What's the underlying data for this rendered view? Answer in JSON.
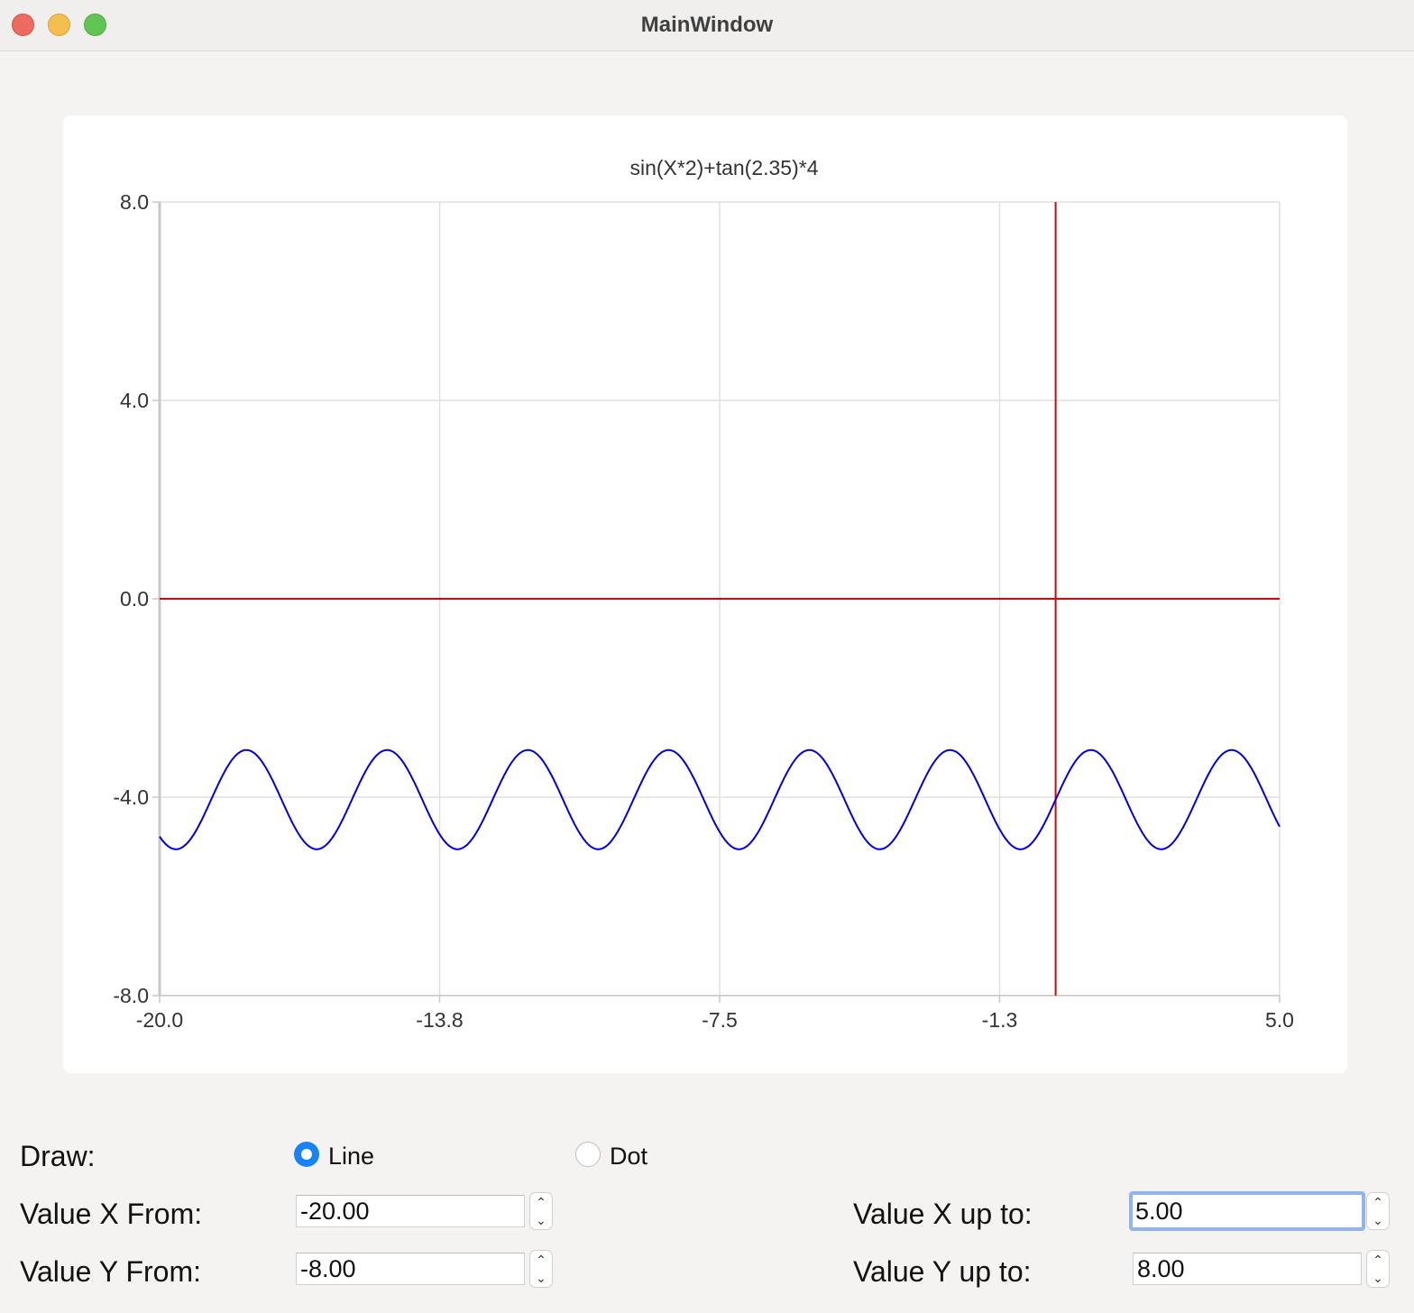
{
  "window": {
    "title": "MainWindow"
  },
  "chart_data": {
    "type": "line",
    "title": "sin(X*2)+tan(2.35)*4",
    "xlabel": "",
    "ylabel": "",
    "xlim": [
      -20.0,
      5.0
    ],
    "ylim": [
      -8.0,
      8.0
    ],
    "x_ticks": [
      "-20.0",
      "-13.8",
      "-7.5",
      "-1.3",
      "5.0"
    ],
    "y_ticks": [
      "8.0",
      "4.0",
      "0.0",
      "-4.0",
      "-8.0"
    ],
    "grid": true,
    "x_tick_values": [
      -20.0,
      -13.75,
      -7.5,
      -1.25,
      5.0
    ],
    "y_tick_values": [
      8.0,
      4.0,
      0.0,
      -4.0,
      -8.0
    ],
    "axes_lines": {
      "horizontal_y": 0.0,
      "vertical_x": 0.0,
      "color": "#e00000"
    },
    "series": [
      {
        "function": "sin(X*2)+tan(2.35)*4",
        "color": "#0000dd",
        "x": [
          -20.0,
          -19.5,
          -19.0,
          -18.5,
          -18.0,
          -17.5,
          -17.0,
          -16.5,
          -16.0,
          -15.5,
          -15.0,
          -14.5,
          -14.0,
          -13.5,
          -13.0,
          -12.5,
          -12.0,
          -11.5,
          -11.0,
          -10.5,
          -10.0,
          -9.5,
          -9.0,
          -8.5,
          -8.0,
          -7.5,
          -7.0,
          -6.5,
          -6.0,
          -5.5,
          -5.0,
          -4.5,
          -4.0,
          -3.5,
          -3.0,
          -2.5,
          -2.0,
          -1.5,
          -1.0,
          -0.5,
          0.0,
          0.5,
          1.0,
          1.5,
          2.0,
          2.5,
          3.0,
          3.5,
          4.0,
          4.5,
          5.0
        ],
        "y": [
          -4.79,
          -5.03,
          -3.85,
          -3.21,
          -4.07,
          -5.0,
          -4.59,
          -3.38,
          -3.31,
          -4.6,
          -4.99,
          -4.06,
          -3.22,
          -3.87,
          -5.03,
          -4.78,
          -3.51,
          -3.17,
          -4.02,
          -4.97,
          -4.11,
          -3.24,
          -3.81,
          -4.96,
          -4.32,
          -3.13,
          -3.46,
          -4.78,
          -4.56,
          -3.24,
          -3.5,
          -4.77,
          -4.95,
          -3.98,
          -3.3,
          -4.03,
          -5.0,
          -4.16,
          -3.13,
          -3.84,
          -4.05,
          -3.21,
          -3.14,
          -3.91,
          -4.81,
          -4.01,
          -3.37,
          -3.73,
          -4.12,
          -3.46,
          -3.78
        ]
      }
    ]
  },
  "controls": {
    "draw_label": "Draw:",
    "line_option": "Line",
    "dot_option": "Dot",
    "selected_draw_mode": "Line",
    "x_from_label": "Value X From:",
    "x_from_value": "-20.00",
    "y_from_label": "Value Y From:",
    "y_from_value": "-8.00",
    "x_to_label": "Value X up to:",
    "x_to_value": "5.00",
    "y_to_label": "Value Y up to:",
    "y_to_value": "8.00"
  },
  "colors": {
    "background": "#f4f3f2",
    "panel": "#ffffff",
    "grid": "#e0e0e0",
    "accent": "#1a82f7",
    "focus_ring": "#8fb5ef"
  },
  "icons": {
    "close": "close-icon",
    "minimize": "minimize-icon",
    "maximize": "maximize-icon",
    "stepper_up": "chevron-up-icon",
    "stepper_down": "chevron-down-icon"
  }
}
